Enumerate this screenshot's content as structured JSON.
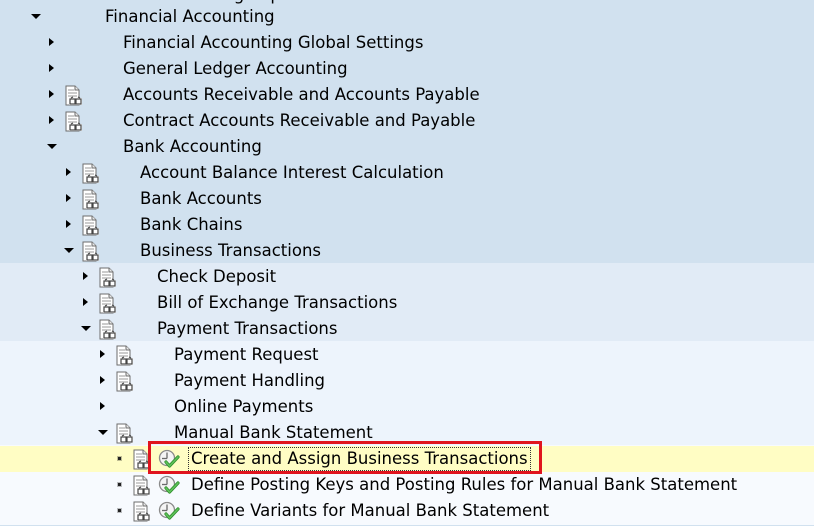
{
  "tree": {
    "partial_top_label": "SAP Customizing Implementation Guide",
    "rows": [
      {
        "label": "Financial Accounting",
        "state": "expanded",
        "has_doc_icon": false,
        "has_exec_icon": false
      },
      {
        "label": "Financial Accounting Global Settings",
        "state": "collapsed",
        "has_doc_icon": false,
        "has_exec_icon": false
      },
      {
        "label": "General Ledger Accounting",
        "state": "collapsed",
        "has_doc_icon": false,
        "has_exec_icon": false
      },
      {
        "label": "Accounts Receivable and Accounts Payable",
        "state": "collapsed",
        "has_doc_icon": true,
        "has_exec_icon": false
      },
      {
        "label": "Contract Accounts Receivable and Payable",
        "state": "collapsed",
        "has_doc_icon": true,
        "has_exec_icon": false
      },
      {
        "label": "Bank Accounting",
        "state": "expanded",
        "has_doc_icon": false,
        "has_exec_icon": false
      },
      {
        "label": "Account Balance Interest Calculation",
        "state": "collapsed",
        "has_doc_icon": true,
        "has_exec_icon": false
      },
      {
        "label": "Bank Accounts",
        "state": "collapsed",
        "has_doc_icon": true,
        "has_exec_icon": false
      },
      {
        "label": "Bank Chains",
        "state": "collapsed",
        "has_doc_icon": true,
        "has_exec_icon": false
      },
      {
        "label": "Business Transactions",
        "state": "expanded",
        "has_doc_icon": true,
        "has_exec_icon": false
      },
      {
        "label": "Check Deposit",
        "state": "collapsed",
        "has_doc_icon": true,
        "has_exec_icon": false
      },
      {
        "label": "Bill of Exchange Transactions",
        "state": "collapsed",
        "has_doc_icon": true,
        "has_exec_icon": false
      },
      {
        "label": "Payment Transactions",
        "state": "expanded",
        "has_doc_icon": true,
        "has_exec_icon": false
      },
      {
        "label": "Payment Request",
        "state": "collapsed",
        "has_doc_icon": true,
        "has_exec_icon": false
      },
      {
        "label": "Payment Handling",
        "state": "collapsed",
        "has_doc_icon": true,
        "has_exec_icon": false
      },
      {
        "label": "Online Payments",
        "state": "collapsed",
        "has_doc_icon": false,
        "has_exec_icon": false
      },
      {
        "label": "Manual Bank Statement",
        "state": "expanded",
        "has_doc_icon": true,
        "has_exec_icon": false
      },
      {
        "label": "Create and Assign Business Transactions",
        "state": "leaf",
        "has_doc_icon": true,
        "has_exec_icon": true,
        "selected": true,
        "highlighted": true
      },
      {
        "label": "Define Posting Keys and Posting Rules for Manual Bank Statement",
        "state": "leaf",
        "has_doc_icon": true,
        "has_exec_icon": true
      },
      {
        "label": "Define Variants for Manual Bank Statement",
        "state": "leaf",
        "has_doc_icon": true,
        "has_exec_icon": true
      }
    ]
  },
  "colors": {
    "level1_bg": "#D1E1EF",
    "level2_bg": "#E1EBF6",
    "level3_bg": "#EDF4FC",
    "level4_bg": "#F7FAFE",
    "selected_bg": "#FFFDC4",
    "highlight_box": "#E0141E",
    "exec_check": "#3DA53A"
  }
}
